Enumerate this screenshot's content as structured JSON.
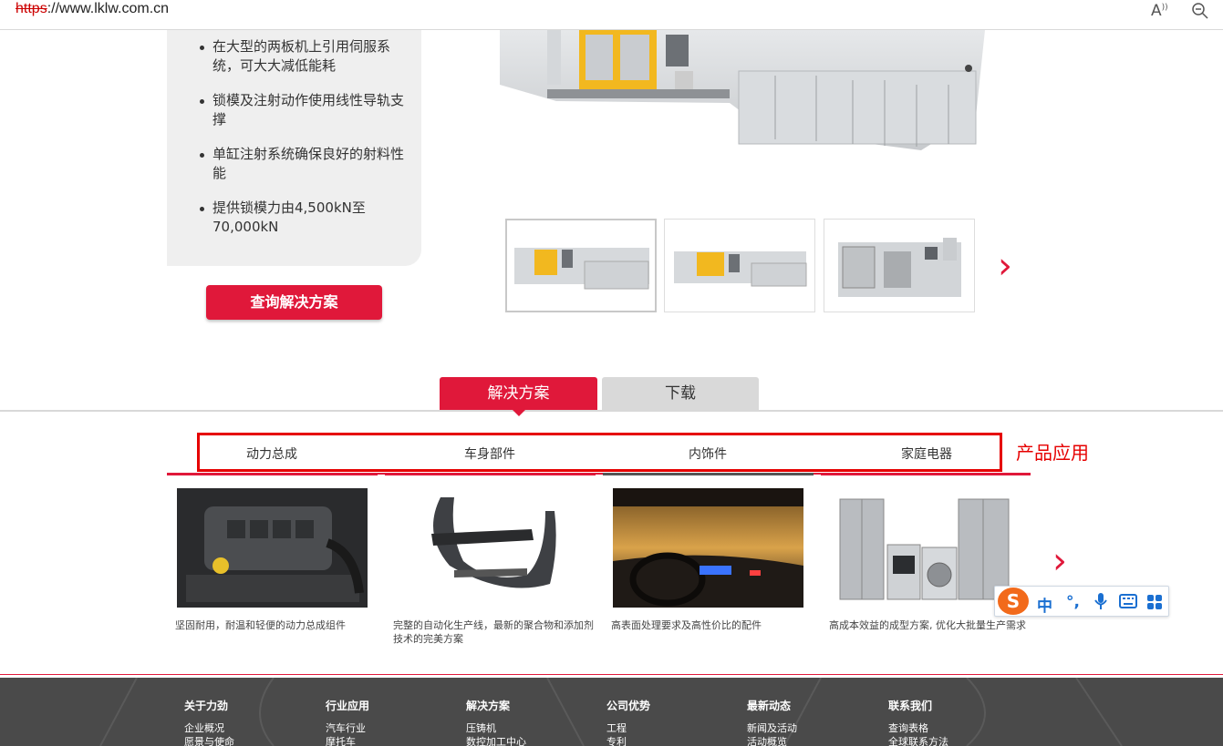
{
  "browser": {
    "url_protocol": "https",
    "url_rest": "://www.lklw.com.cn",
    "read_aloud_icon": "read-aloud-icon",
    "zoom_icon": "zoom-out-icon"
  },
  "features": [
    "在大型的两板机上引用伺服系统，可大大减低能耗",
    "锁模及注射动作使用线性导轨支撑",
    "单缸注射系统确保良好的射料性能",
    "提供锁模力由4,500kN至70,000kN"
  ],
  "inquiry_button": "查询解决方案",
  "tabs": [
    {
      "label": "解决方案",
      "active": true
    },
    {
      "label": "下载",
      "active": false
    }
  ],
  "categories": [
    "动力总成",
    "车身部件",
    "内饰件",
    "家庭电器"
  ],
  "annotation": "产品应用",
  "cards": [
    {
      "desc": "坚固耐用，耐温和轻便的动力总成组件",
      "image": "engine-image"
    },
    {
      "desc": "完整的自动化生产线，最新的聚合物和添加剂技术的完美方案",
      "image": "bumper-image"
    },
    {
      "desc": "高表面处理要求及高性价比的配件",
      "image": "car-interior-image"
    },
    {
      "desc": "高成本效益的成型方案, 优化大批量生产需求",
      "image": "appliances-image"
    }
  ],
  "ime": {
    "logo": "S",
    "lang": "中",
    "punct": "°,",
    "mic": "mic-icon",
    "keyboard": "keyboard-icon",
    "apps": "apps-icon"
  },
  "footer": [
    {
      "head": "关于力劲",
      "links": [
        "企业概况",
        "愿景与使命"
      ]
    },
    {
      "head": "行业应用",
      "links": [
        "汽车行业",
        "摩托车"
      ]
    },
    {
      "head": "解决方案",
      "links": [
        "压铸机",
        "数控加工中心"
      ]
    },
    {
      "head": "公司优势",
      "links": [
        "工程",
        "专利"
      ]
    },
    {
      "head": "最新动态",
      "links": [
        "新闻及活动",
        "活动概览"
      ]
    },
    {
      "head": "联系我们",
      "links": [
        "查询表格",
        "全球联系方法"
      ]
    }
  ],
  "colors": {
    "brand_red": "#e0183a",
    "annotation_red": "#e60000",
    "footer_bg": "#4a4a4a"
  }
}
